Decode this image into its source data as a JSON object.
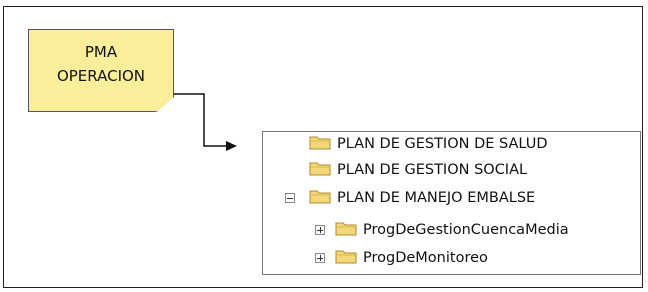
{
  "note": {
    "line1": "PMA",
    "line2": "OPERACION"
  },
  "tree": {
    "items": [
      {
        "label": "PLAN DE GESTION DE SALUD",
        "level": 0,
        "expander": "none"
      },
      {
        "label": "PLAN DE GESTION SOCIAL",
        "level": 0,
        "expander": "none"
      },
      {
        "label": "PLAN DE MANEJO EMBALSE",
        "level": 0,
        "expander": "minus"
      },
      {
        "label": "ProgDeGestionCuencaMedia",
        "level": 1,
        "expander": "plus"
      },
      {
        "label": "ProgDeMonitoreo",
        "level": 1,
        "expander": "plus"
      }
    ]
  },
  "colors": {
    "note_fill": "#fbee9a",
    "folder_fill": "#f3d87a",
    "folder_stroke": "#b08a2e"
  }
}
